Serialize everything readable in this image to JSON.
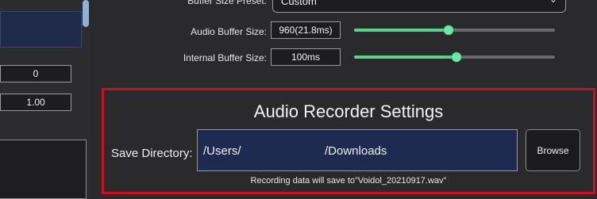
{
  "left": {
    "field_1": "0",
    "field_2": "1.00"
  },
  "buffer": {
    "preset_label": "Buffer Size Preset:",
    "preset_value": "Custom",
    "audio_label": "Audio Buffer Size:",
    "audio_value": "960(21.8ms)",
    "audio_level": 0.47,
    "internal_label": "Internal Buffer Size:",
    "internal_value": "100ms",
    "internal_level": 0.51
  },
  "recorder": {
    "title": "Audio Recorder Settings",
    "save_label": "Save Directory:",
    "dir_part1": "/Users/",
    "dir_part2": "/Downloads",
    "browse_label": "Browse",
    "note": "Recording data will save to\"Voidol_20210917.wav\""
  },
  "colors": {
    "accent_green": "#57d38a",
    "highlight_red": "#c8101e",
    "field_navy": "#1e2a4f"
  }
}
